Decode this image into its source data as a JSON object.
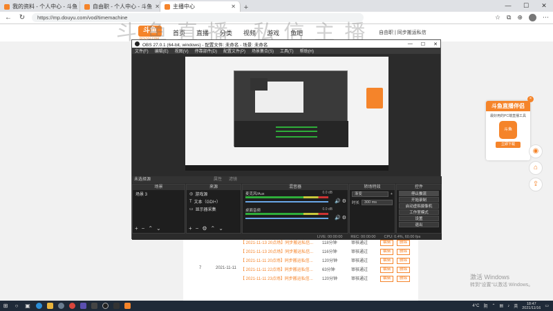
{
  "browser": {
    "tabs": [
      {
        "label": "我的资料 - 个人中心 - 斗鱼",
        "active": false
      },
      {
        "label": "自由职 - 个人中心 - 斗鱼",
        "active": false
      },
      {
        "label": "主播中心",
        "active": true
      }
    ],
    "url": "https://mp.douyu.com/vod/timemachine",
    "win_min": "—",
    "win_max": "☐",
    "win_close": "✕"
  },
  "site": {
    "logo": "斗鱼",
    "logo_sub": "DOUYU.COM",
    "nav": [
      "首页",
      "直播",
      "分类",
      "视频",
      "游戏",
      "鱼吧"
    ],
    "watermark": "斗鱼直播 私信主播",
    "header_right": "自由职 | 同步搬运私信"
  },
  "obs": {
    "title": "OBS 27.0.1 (64-bit, windows) - 配置文件: 未命名 - 场景: 未命名",
    "menu": [
      "文件(F)",
      "编辑(E)",
      "视图(V)",
      "停靠部件(D)",
      "配置文件(P)",
      "场景集合(S)",
      "工具(T)",
      "帮助(H)"
    ],
    "selection_bar": {
      "label": "未选择源",
      "props": "属性",
      "filters": "滤镜"
    },
    "docks": {
      "scenes": {
        "title": "场景",
        "items": [
          "场景 3"
        ]
      },
      "sources": {
        "title": "来源",
        "items": [
          "游戏源",
          "文本（GDI+）",
          "显示器采集"
        ]
      },
      "mixer": {
        "title": "混音器",
        "channels": [
          {
            "name": "麦克风/Aux",
            "db": "0.0 dB"
          },
          {
            "name": "桌面音频",
            "db": "0.0 dB"
          }
        ]
      },
      "transitions": {
        "title": "转场特效",
        "type": "渐变",
        "duration_label": "时长",
        "duration": "300 ms"
      },
      "controls": {
        "title": "控件",
        "buttons": [
          "停止推流",
          "开始录制",
          "启动虚拟摄像机",
          "工作室模式",
          "设置",
          "退出"
        ]
      }
    },
    "status": {
      "live": "LIVE: 00:00:00",
      "rec": "REC: 00:00:00",
      "cpu": "CPU: 0.4%, 60.00 fps"
    }
  },
  "table": {
    "rows": [
      {
        "num": "",
        "date": "",
        "title": "【 2021-11-13 20点场】同步搬运私信...",
        "duration": "118分钟",
        "status": "审核通过",
        "b1": "编辑",
        "b2": "删除"
      },
      {
        "num": "",
        "date": "",
        "title": "【 2021-11-13 20点场】同步搬运私信...",
        "duration": "116分钟",
        "status": "审核通过",
        "b1": "编辑",
        "b2": "删除"
      },
      {
        "num": "",
        "date": "",
        "title": "【 2021-11-11 20点场】同步搬运私信...",
        "duration": "120分钟",
        "status": "审核通过",
        "b1": "编辑",
        "b2": "删除"
      },
      {
        "num": "7",
        "date": "2021-11-11",
        "title": "【 2021-11-11 22点场】同步搬运私信...",
        "duration": "63分钟",
        "status": "审核通过",
        "b1": "编辑",
        "b2": "删除"
      },
      {
        "num": "",
        "date": "",
        "title": "【 2021-11-11 23点场】同步搬运私信...",
        "duration": "120分钟",
        "status": "审核通过",
        "b1": "编辑",
        "b2": "删除"
      }
    ]
  },
  "widget": {
    "title": "斗鱼直播伴侣",
    "sub": "最好用的PC端直播工具",
    "logo": "斗鱼",
    "button": "立即下载",
    "close": "×"
  },
  "side_buttons": [
    "◉",
    "⌂",
    "⇪"
  ],
  "windows_activate": {
    "line1": "激活 Windows",
    "line2": "转到\"设置\"以激活 Windows。"
  },
  "taskbar": {
    "temp": "4°C",
    "weather": "阴",
    "ime": "英",
    "time": "18:47",
    "date": "2021/11/16"
  }
}
